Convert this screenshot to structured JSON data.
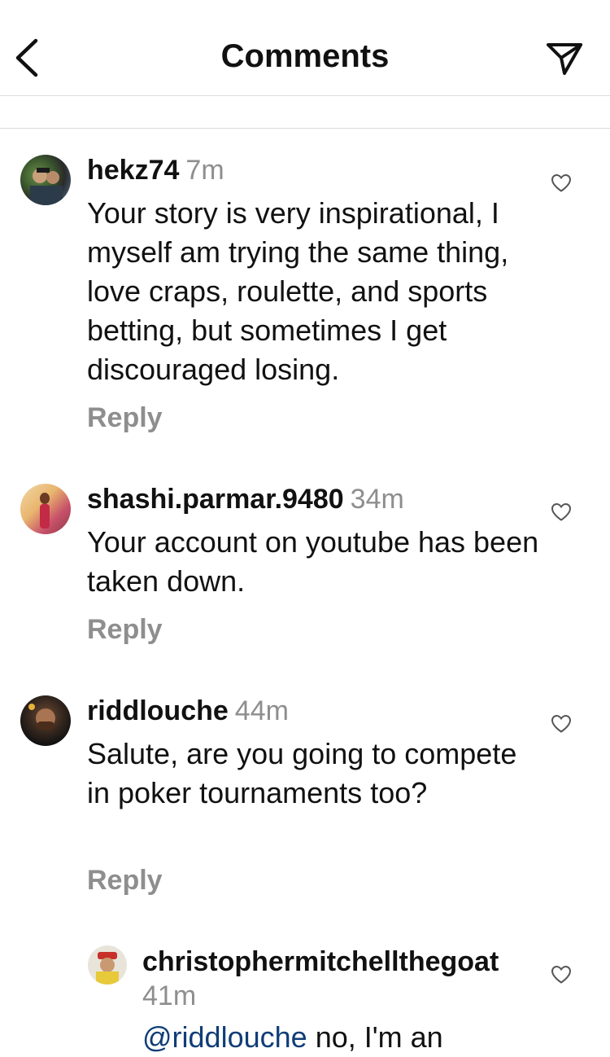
{
  "header": {
    "title": "Comments"
  },
  "comments": [
    {
      "username": "hekz74",
      "time": "7m",
      "text": "Your story is very inspirational, I myself am trying the same thing, love craps, roulette, and sports betting, but sometimes I get discouraged losing.",
      "reply_label": "Reply"
    },
    {
      "username": "shashi.parmar.9480",
      "time": "34m",
      "text": "Your account on youtube has been taken down.",
      "reply_label": "Reply"
    },
    {
      "username": "riddlouche",
      "time": "44m",
      "text": "Salute, are you going to compete in poker tournaments too?",
      "reply_label": "Reply"
    }
  ],
  "replies": [
    {
      "username": "christophermitchellthegoat",
      "time": "41m",
      "mention": "@riddlouche",
      "text": "no, I'm an"
    }
  ],
  "icons": {
    "back": "chevron-left-icon",
    "send": "paper-plane-icon",
    "like": "heart-outline-icon"
  }
}
